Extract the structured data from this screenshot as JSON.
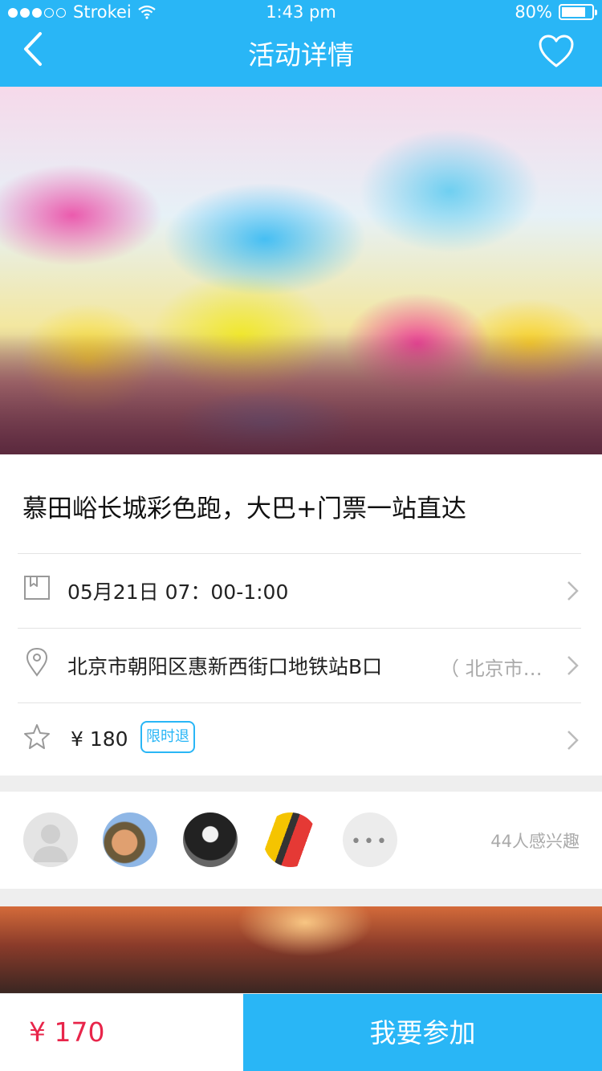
{
  "status_bar": {
    "carrier": "Strokei",
    "time": "1:43 pm",
    "battery": "80%"
  },
  "nav": {
    "title": "活动详情"
  },
  "event": {
    "title": "慕田峪长城彩色跑，大巴+门票一站直达",
    "date": "05月21日 07：00-1:00",
    "address": "北京市朝阳区惠新西街口地铁站B口",
    "address_extra": "（ 北京市…",
    "price": "¥  180",
    "price_badge": "限时退"
  },
  "participants": {
    "interested_text": "44人感兴趣",
    "more_label": "•••"
  },
  "footer": {
    "price": "¥ 170",
    "join_label": "我要参加"
  },
  "colors": {
    "accent": "#29b6f6",
    "price_red": "#e8254a"
  },
  "icons": [
    "back-icon",
    "heart-icon",
    "calendar-icon",
    "location-pin-icon",
    "star-icon",
    "chevron-right-icon",
    "wifi-icon",
    "battery-icon"
  ]
}
